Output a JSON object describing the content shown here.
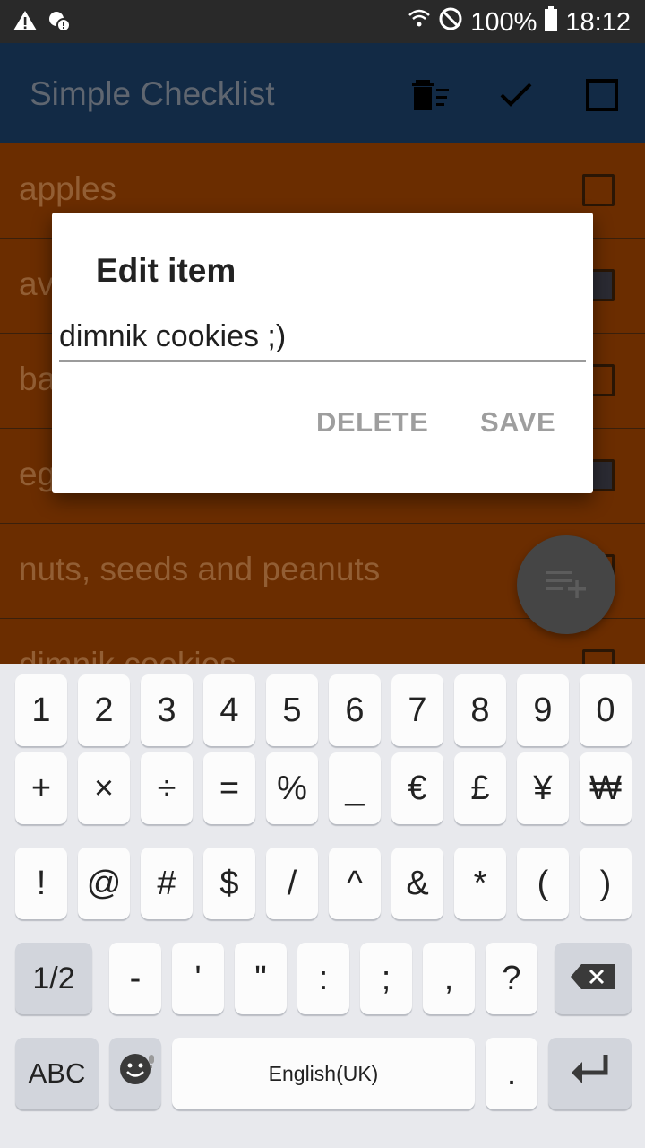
{
  "status_bar": {
    "icons_left": [
      "warning-icon",
      "account-alert-icon"
    ],
    "icons_right": [
      "wifi-question-icon",
      "no-disturb-icon"
    ],
    "battery": "100%",
    "time": "18:12"
  },
  "app_bar": {
    "title": "Simple Checklist",
    "actions": [
      "delete-checked-icon",
      "check-icon",
      "checkbox-icon"
    ]
  },
  "list": {
    "items": [
      {
        "label": "apples",
        "checked": false
      },
      {
        "label": "av",
        "checked": true
      },
      {
        "label": "ba",
        "checked": false
      },
      {
        "label": "eg",
        "checked": true
      },
      {
        "label": "nuts, seeds and peanuts",
        "checked": false
      },
      {
        "label": "dimnik cookies",
        "checked": false
      }
    ]
  },
  "dialog": {
    "title": "Edit item",
    "input_value": "dimnik cookies ;)",
    "buttons": {
      "delete": "DELETE",
      "save": "SAVE"
    }
  },
  "keyboard": {
    "row1": [
      "1",
      "2",
      "3",
      "4",
      "5",
      "6",
      "7",
      "8",
      "9",
      "0"
    ],
    "row2": [
      "+",
      "×",
      "÷",
      "=",
      "%",
      "_",
      "€",
      "£",
      "¥",
      "₩"
    ],
    "row3": [
      "!",
      "@",
      "#",
      "$",
      "/",
      "^",
      "&",
      "*",
      "(",
      ")"
    ],
    "row4": [
      "1/2",
      "-",
      "'",
      "\"",
      ":",
      ";",
      ",",
      "?"
    ],
    "row5": {
      "abc": "ABC",
      "space": "English(UK)",
      "period": "."
    }
  }
}
